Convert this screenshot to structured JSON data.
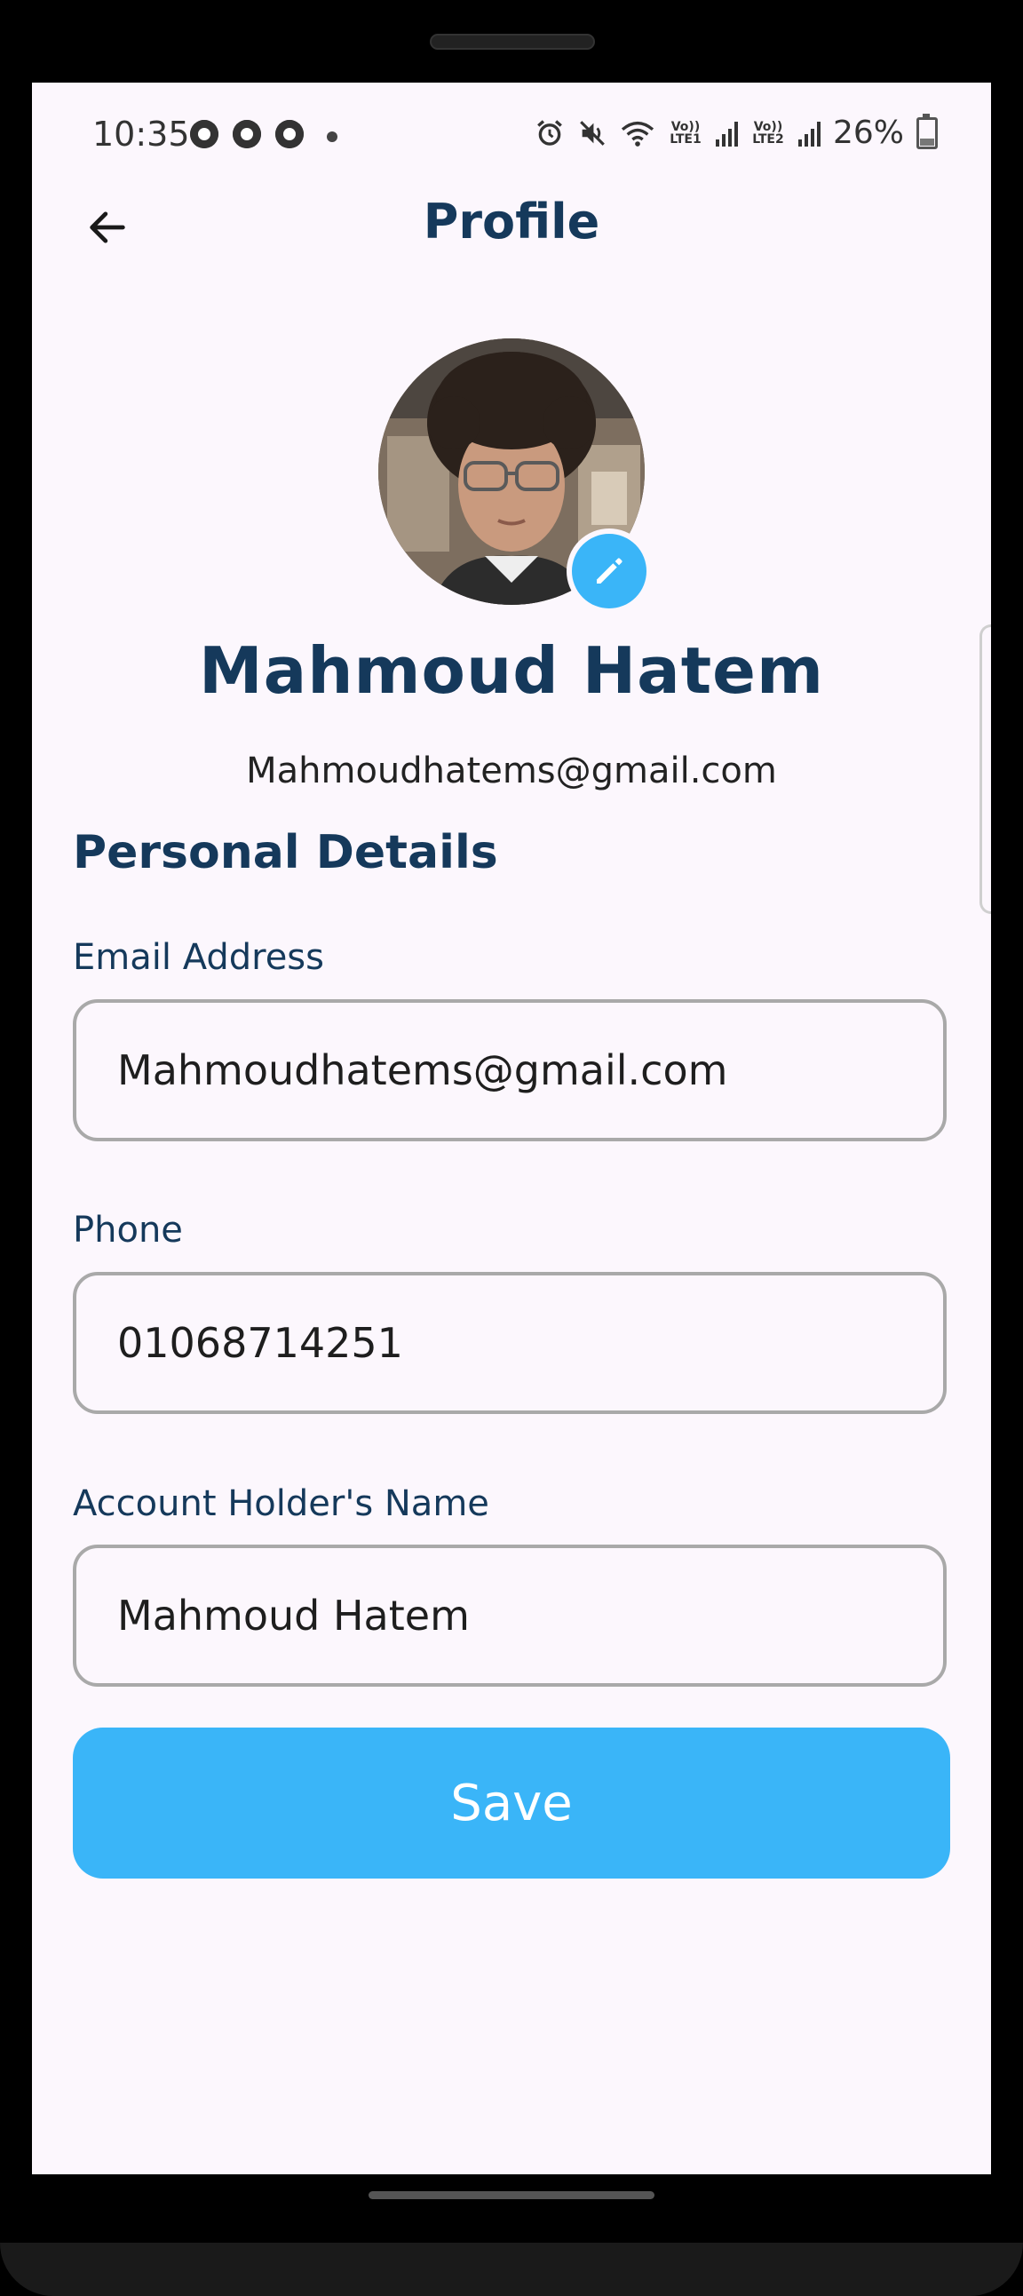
{
  "status_bar": {
    "time": "10:35",
    "lte1": "Vo)) LTE1",
    "lte2": "Vo)) LTE2",
    "battery": "26%"
  },
  "header": {
    "title": "Profile"
  },
  "profile": {
    "name": "Mahmoud Hatem",
    "email": "Mahmoudhatems@gmail.com"
  },
  "section": {
    "title": "Personal Details"
  },
  "fields": [
    {
      "label": "Email Address",
      "value": "Mahmoudhatems@gmail.com"
    },
    {
      "label": "Phone",
      "value": "01068714251"
    },
    {
      "label": "Account Holder's Name",
      "value": "Mahmoud Hatem"
    }
  ],
  "actions": {
    "save_label": "Save"
  },
  "colors": {
    "primary_text": "#15395b",
    "accent": "#3ab5f8",
    "background": "#fcf7fd",
    "field_border": "#a9a9a9"
  },
  "icons": {
    "back": "arrow-left-icon",
    "edit_avatar": "pencil-icon"
  }
}
